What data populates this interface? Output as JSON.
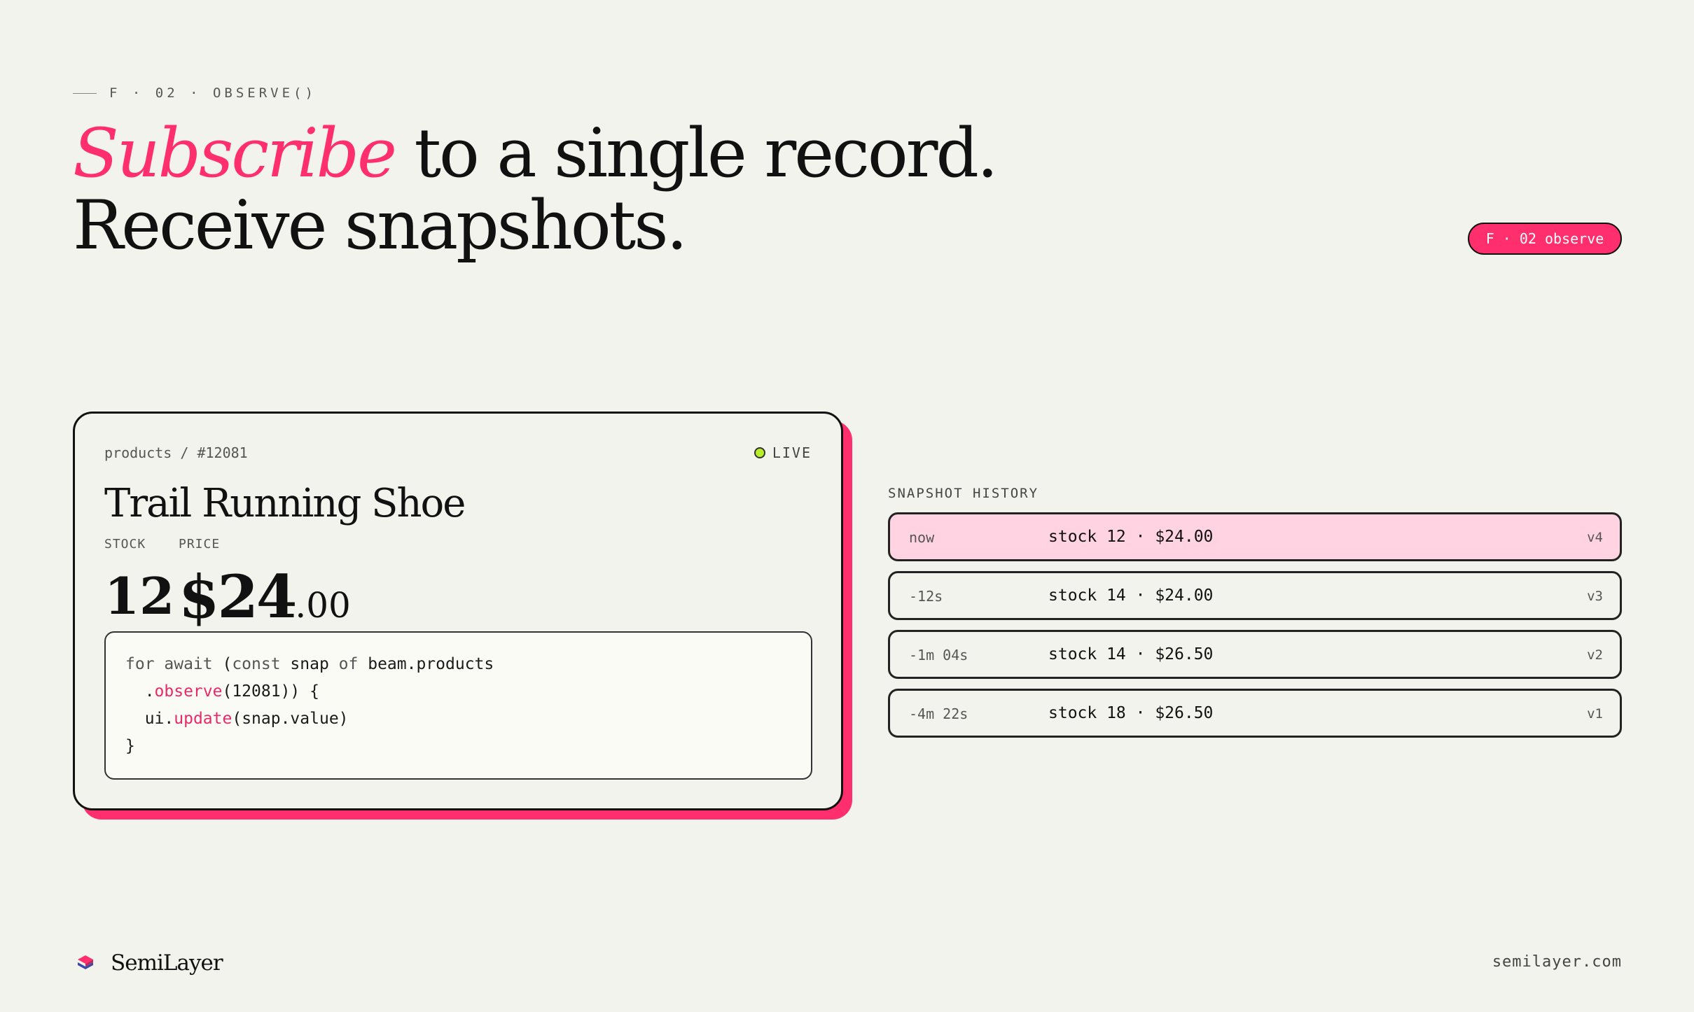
{
  "header": {
    "eyebrow": "F · 02 · OBSERVE()",
    "headline_accent": "Subscribe",
    "headline_rest_line1": " to a single record.",
    "headline_line2": "Receive snapshots.",
    "badge": "F · 02 observe"
  },
  "card": {
    "breadcrumb": "products / #12081",
    "live_label": "LIVE",
    "title": "Trail Running Shoe",
    "stock_label": "STOCK",
    "price_label": "PRICE",
    "stock_value": "12",
    "price_int": "$24",
    "price_cents": ".00",
    "code": {
      "line1_kw1": "for await",
      "line1_mid1": " (",
      "line1_kw2": "const",
      "line1_mid2": " snap ",
      "line1_kw3": "of",
      "line1_end": " beam.products",
      "line2_pre": "  .",
      "line2_fn": "observe",
      "line2_end": "(12081)) {",
      "line3_pre": "  ui.",
      "line3_fn": "update",
      "line3_end": "(snap.value)",
      "line4": "}"
    }
  },
  "history": {
    "label": "SNAPSHOT HISTORY",
    "rows": [
      {
        "time": "now",
        "value": "stock 12 · $24.00",
        "version": "v4"
      },
      {
        "time": "-12s",
        "value": "stock 14 · $24.00",
        "version": "v3"
      },
      {
        "time": "-1m 04s",
        "value": "stock 14 · $26.50",
        "version": "v2"
      },
      {
        "time": "-4m 22s",
        "value": "stock 18 · $26.50",
        "version": "v1"
      }
    ]
  },
  "footer": {
    "brand": "SemiLayer",
    "site": "semilayer.com"
  },
  "colors": {
    "accent": "#ff2f6e",
    "highlight_row": "#ffd3e1",
    "live_dot": "#b8ee2a",
    "background": "#f3f3ee"
  },
  "icons": {
    "brand": "layers-logo-icon",
    "live": "status-dot-icon"
  }
}
